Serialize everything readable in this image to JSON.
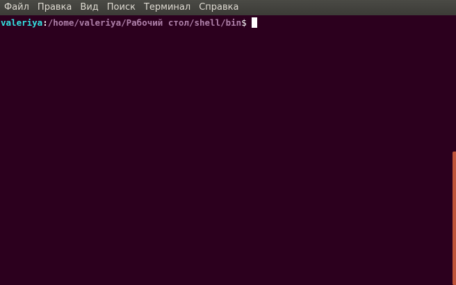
{
  "menu": {
    "items": [
      "Файл",
      "Правка",
      "Вид",
      "Поиск",
      "Терминал",
      "Справка"
    ]
  },
  "terminal": {
    "user": "valeriya",
    "colon": ":",
    "path": "/home/valeriya/Рабочий стол/shell/bin",
    "dollar": "$"
  },
  "colors": {
    "background": "#2c001e",
    "user": "#34e2e2",
    "path": "#ad7fa8",
    "scrollbar_thumb": "#c0543a"
  }
}
